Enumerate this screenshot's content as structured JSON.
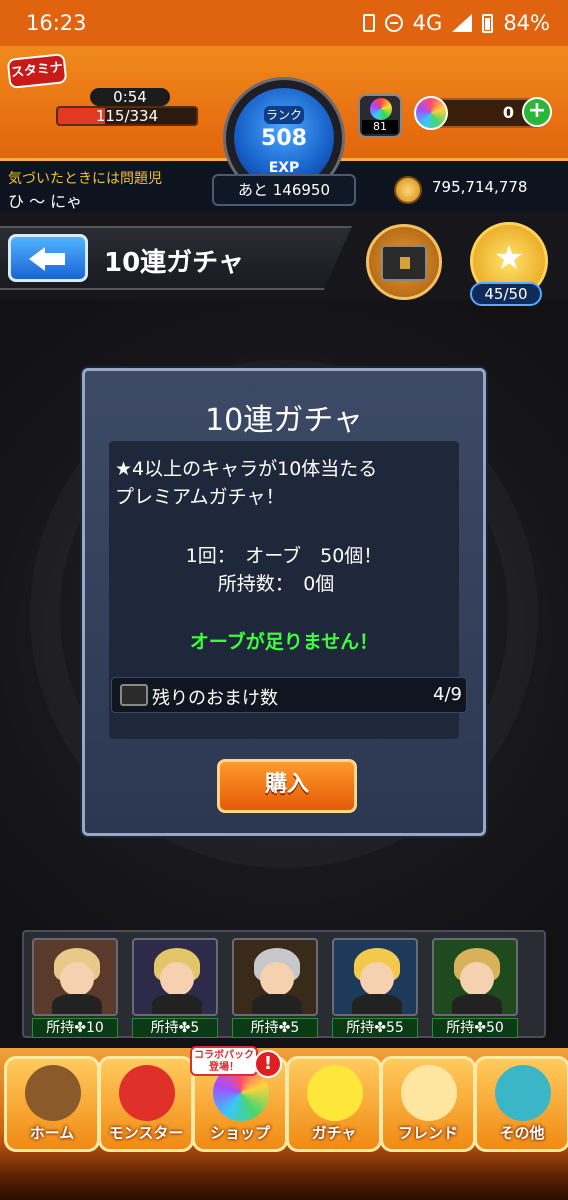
{
  "status_bar": {
    "time": "16:23",
    "network": "4G",
    "battery": "84%"
  },
  "header": {
    "stamina_label": "スタミナ",
    "stamina_timer": "0:54",
    "stamina_value": "115/334",
    "stamina_fraction": 0.344,
    "rank_label": "ランク",
    "rank_value": "508",
    "exp_label": "EXP",
    "exp_remaining": "あと 146950",
    "pack_count": "81",
    "orb_count": "0",
    "notice": "気づいたときには問題児",
    "username": "ひ ～ にゃ",
    "gold": "795,714,778"
  },
  "title_bar": {
    "title": "10連ガチャ",
    "star_count": "45/50"
  },
  "dialog": {
    "title": "10連ガチャ",
    "description_line1": "★4以上のキャラが10体当たる",
    "description_line2": "プレミアムガチャ！",
    "cost_line": "1回：　オーブ　50個！",
    "owned_line": "所持数：　0個",
    "warning": "オーブが足りません！",
    "bonus_label": "残りのおまけ数",
    "bonus_value": "4/9",
    "buy_label": "購入"
  },
  "characters": [
    {
      "owned": "所持✤10",
      "hair": "#e9c98a",
      "bg": "#5a3a2a"
    },
    {
      "owned": "所持✤5",
      "hair": "#e4c66a",
      "bg": "#2e2a4a"
    },
    {
      "owned": "所持✤5",
      "hair": "#c8c8cc",
      "bg": "#3a2a1a"
    },
    {
      "owned": "所持✤55",
      "hair": "#f2c94a",
      "bg": "#1e3a5a"
    },
    {
      "owned": "所持✤50",
      "hair": "#d8b25a",
      "bg": "#1e4a1e"
    }
  ],
  "bottom_nav": {
    "badge": "コラボパック\n登場！",
    "items": [
      {
        "label": "ホーム",
        "icon": "home-icon"
      },
      {
        "label": "モンスター",
        "icon": "monster-icon"
      },
      {
        "label": "ショップ",
        "icon": "shop-icon"
      },
      {
        "label": "ガチャ",
        "icon": "gacha-icon"
      },
      {
        "label": "フレンド",
        "icon": "friend-icon"
      },
      {
        "label": "その他",
        "icon": "other-icon"
      }
    ]
  },
  "colors": {
    "accent_orange": "#e66e10",
    "warning_green": "#3cff3c",
    "dialog_bg": "#2c3750"
  }
}
